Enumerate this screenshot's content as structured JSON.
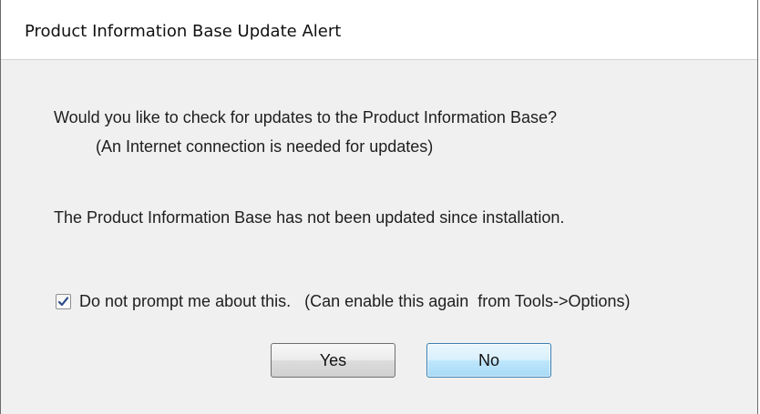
{
  "window": {
    "title": "Product Information Base Update Alert"
  },
  "message": {
    "question": "Would you like to check for updates to the Product Information Base?",
    "note": "(An Internet connection is needed for updates)",
    "status": "The Product Information Base has not been updated since installation."
  },
  "prompt_checkbox": {
    "label": "Do not prompt me about this.   (Can enable this again  from Tools->Options)",
    "checked": true
  },
  "buttons": {
    "yes_label": "Yes",
    "no_label": "No"
  },
  "colors": {
    "dialog_background": "#f0f0f0",
    "title_background": "#ffffff",
    "default_button_border": "#3c7fb1",
    "checkmark": "#2a4a8a"
  }
}
